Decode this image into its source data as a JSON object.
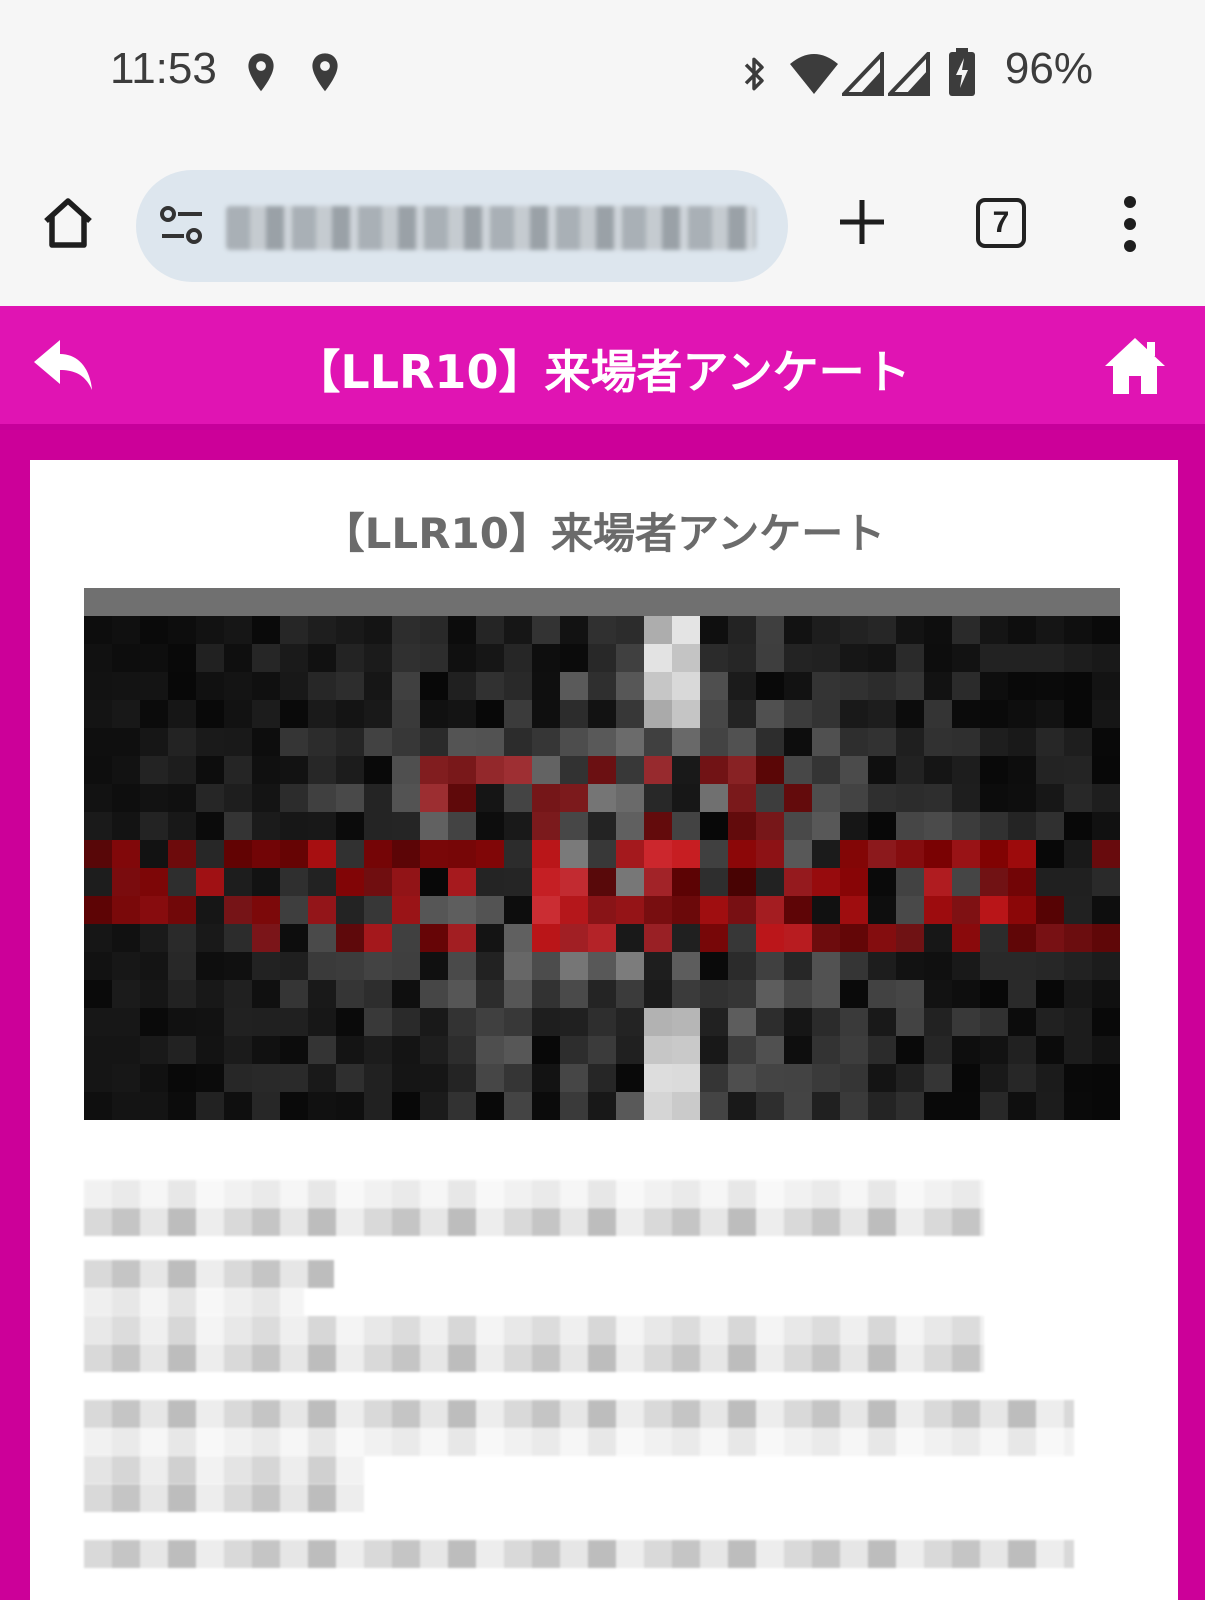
{
  "status_bar": {
    "time": "11:53",
    "battery": "96%",
    "icons": [
      "location-icon",
      "location-icon",
      "bluetooth-icon",
      "wifi-icon",
      "signal-icon",
      "signal-icon",
      "battery-charging-icon"
    ]
  },
  "browser": {
    "tab_count": "7",
    "icons": [
      "home-icon",
      "tune-icon",
      "plus-icon",
      "tabs-icon",
      "more-vert-icon"
    ]
  },
  "header": {
    "title": "【LLR10】来場者アンケート",
    "icons": [
      "back-reply-icon",
      "home-icon"
    ]
  },
  "content": {
    "title": "【LLR10】来場者アンケート"
  },
  "colors": {
    "header_bg": "#e014b3",
    "page_bg": "#cc0099",
    "card_bg": "#ffffff"
  }
}
